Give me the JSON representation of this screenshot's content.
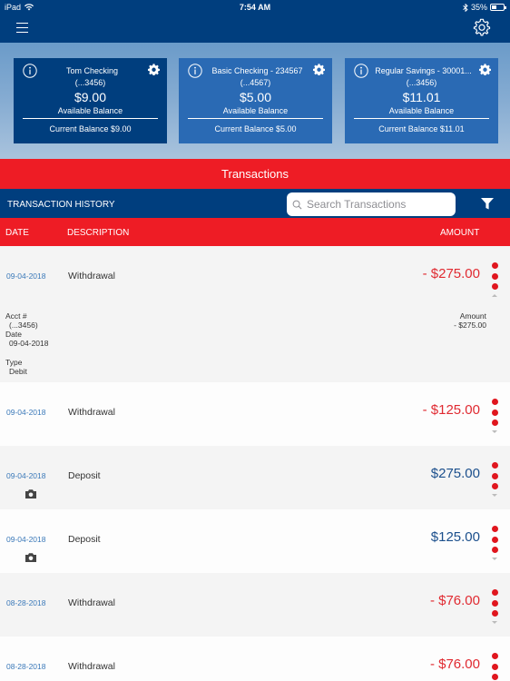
{
  "status_bar": {
    "device": "iPad",
    "time": "7:54 AM",
    "battery": "35%"
  },
  "nav": {
    "menu_icon": "hamburger-icon",
    "settings_icon": "gear-icon"
  },
  "accounts": [
    {
      "name": "Tom Checking",
      "number": "(...3456)",
      "balance": "$9.00",
      "available_label": "Available Balance",
      "current": "Current Balance $9.00",
      "selected": true
    },
    {
      "name": "Basic Checking - 234567",
      "number": "(...4567)",
      "balance": "$5.00",
      "available_label": "Available Balance",
      "current": "Current Balance $5.00",
      "selected": false
    },
    {
      "name": "Regular Savings - 30001...",
      "number": "(...3456)",
      "balance": "$11.01",
      "available_label": "Available Balance",
      "current": "Current Balance $11.01",
      "selected": false
    }
  ],
  "transactions_title": "Transactions",
  "history": {
    "label": "TRANSACTION HISTORY",
    "search_placeholder": "Search Transactions",
    "search_value": ""
  },
  "columns": {
    "date": "DATE",
    "description": "DESCRIPTION",
    "amount": "AMOUNT"
  },
  "transactions": [
    {
      "date": "09-04-2018",
      "description": "Withdrawal",
      "amount": "- $275.00",
      "type": "debit",
      "has_image": false,
      "expanded": true
    },
    {
      "date": "09-04-2018",
      "description": "Withdrawal",
      "amount": "- $125.00",
      "type": "debit",
      "has_image": false,
      "expanded": false
    },
    {
      "date": "09-04-2018",
      "description": "Deposit",
      "amount": "$275.00",
      "type": "credit",
      "has_image": true,
      "expanded": false
    },
    {
      "date": "09-04-2018",
      "description": "Deposit",
      "amount": "$125.00",
      "type": "credit",
      "has_image": true,
      "expanded": false
    },
    {
      "date": "08-28-2018",
      "description": "Withdrawal",
      "amount": "- $76.00",
      "type": "debit",
      "has_image": false,
      "expanded": false
    },
    {
      "date": "08-28-2018",
      "description": "Withdrawal",
      "amount": "- $76.00",
      "type": "debit",
      "has_image": false,
      "expanded": false
    }
  ],
  "expanded_detail": {
    "acct_label": "Acct #",
    "acct_value": "(...3456)",
    "date_label": "Date",
    "date_value": "09-04-2018",
    "type_label": "Type",
    "type_value": "Debit",
    "amount_label": "Amount",
    "amount_value": "- $275.00"
  },
  "colors": {
    "navy": "#003e7e",
    "red": "#ee1c25",
    "card_blue": "#2a6ab4",
    "debit": "#e02a31",
    "credit": "#1b4f8c",
    "date_link": "#3b79b9"
  }
}
